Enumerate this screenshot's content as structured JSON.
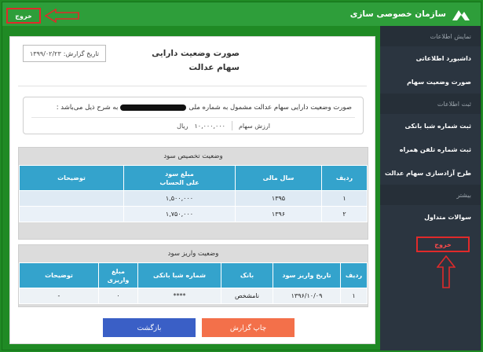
{
  "header": {
    "brand": "سازمان خصوصی سازی",
    "logout": "خروج"
  },
  "sidebar": {
    "sections": [
      {
        "title": "نمایش اطلاعات",
        "items": [
          "داشبورد اطلاعاتی",
          "صورت وضعیت سهام"
        ]
      },
      {
        "title": "ثبت اطلاعات",
        "items": [
          "ثبت شماره شبا بانکی",
          "ثبت شماره تلفن همراه",
          "طرح آزادسازی سهام عدالت"
        ]
      },
      {
        "title": "بیشتر",
        "items": [
          "سوالات متداول",
          "خروج"
        ]
      }
    ]
  },
  "report": {
    "title": "صورت وضعیت دارایی سهام عدالت",
    "date_label": "تاریخ گزارش:",
    "date_value": "۱۳۹۹/۰۲/۲۳",
    "description_prefix": "صورت وضعیت دارایی سهام عدالت مشمول به شماره ملی",
    "description_suffix": "به شرح ذیل می‌باشد :",
    "stock_value_label": "ارزش سهام",
    "stock_value": "۱۰,۰۰۰,۰۰۰",
    "stock_value_unit": "ریال"
  },
  "allocation": {
    "title": "وضعیت تخصیص سود",
    "headers": [
      "ردیف",
      "سال مالی",
      "مبلغ سود",
      "علی الحساب",
      "توضیحات"
    ],
    "rows": [
      [
        "۱",
        "۱۳۹۵",
        "۱,۵۰۰,۰۰۰",
        ""
      ],
      [
        "۲",
        "۱۳۹۶",
        "۱,۷۵۰,۰۰۰",
        ""
      ]
    ]
  },
  "deposit": {
    "title": "وضعیت واریز سود",
    "headers": [
      "ردیف",
      "تاریخ واریز سود",
      "بانک",
      "شماره شبا بانکی",
      "مبلغ",
      "واریزی",
      "توضیحات"
    ],
    "rows": [
      [
        "۱",
        "۱۳۹۶/۱۰/۰۹",
        "نامشخص",
        "****",
        "۰",
        "-"
      ]
    ]
  },
  "buttons": {
    "print": "چاپ گزارش",
    "back": "بازگشت"
  },
  "colors": {
    "header_green": "#2e9e3a",
    "sidebar_dark": "#2b3540",
    "table_header_blue": "#34a3cc",
    "print_orange": "#f3704a",
    "back_blue": "#3a5fc6",
    "highlight_red": "#e02a2a"
  }
}
